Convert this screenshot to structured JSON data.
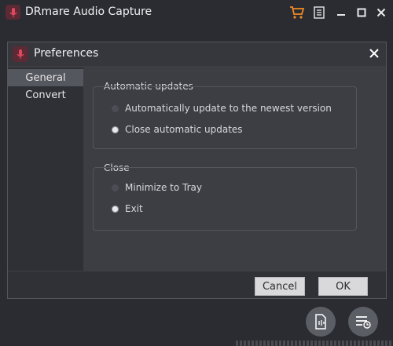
{
  "app": {
    "title": "DRmare Audio Capture",
    "icons": [
      "app-logo-icon",
      "cart-icon",
      "menu-icon",
      "minimize-icon",
      "maximize-icon",
      "close-icon"
    ],
    "bottom_icons": [
      "audio-file-icon",
      "history-list-icon"
    ],
    "accent": "#f08a24"
  },
  "dialog": {
    "title": "Preferences",
    "sidebar": [
      {
        "label": "General",
        "active": true
      },
      {
        "label": "Convert",
        "active": false
      }
    ],
    "groups": [
      {
        "title": "Automatic updates",
        "options": [
          {
            "label": "Automatically update to the newest version",
            "checked": false
          },
          {
            "label": "Close automatic updates",
            "checked": true
          }
        ]
      },
      {
        "title": "Close",
        "options": [
          {
            "label": "Minimize to Tray",
            "checked": false
          },
          {
            "label": "Exit",
            "checked": true
          }
        ]
      }
    ],
    "buttons": {
      "cancel": "Cancel",
      "ok": "OK"
    }
  }
}
